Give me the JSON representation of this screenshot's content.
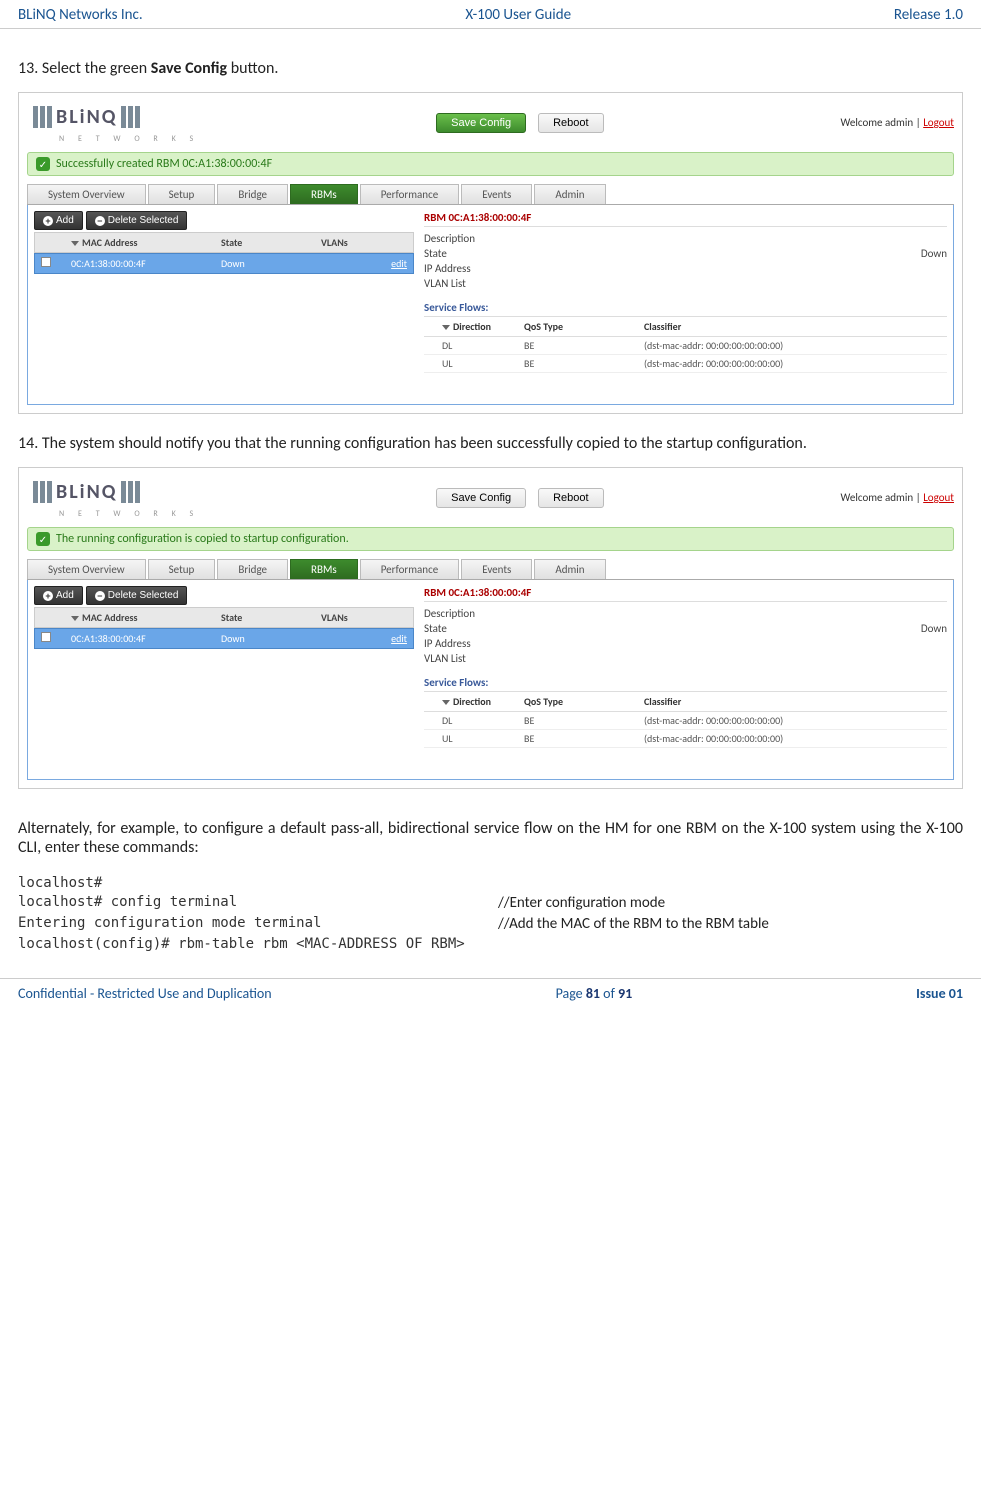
{
  "header": {
    "left": "BLiNQ Networks Inc.",
    "center": "X-100 User Guide",
    "right": "Release 1.0"
  },
  "step13": {
    "prefix": "13. Select the green ",
    "bold": "Save Config",
    "suffix": " button."
  },
  "step14": "14. The system should notify you that the running configuration has been successfully copied to the startup configuration.",
  "alt_para": "Alternately, for example, to configure a default pass-all, bidirectional service flow on the HM for one RBM on the X-100 system using the X-100 CLI, enter these commands:",
  "logo": {
    "main": "BLiNQ",
    "sub": "N E T W O R K S"
  },
  "buttons": {
    "save": "Save Config",
    "reboot": "Reboot"
  },
  "welcome": {
    "text": "Welcome admin  |  ",
    "logout": "Logout"
  },
  "banner1": "Successfully created RBM 0C:A1:38:00:00:4F",
  "banner2": "The running configuration is copied to startup configuration.",
  "tabs": {
    "overview": "System Overview",
    "setup": "Setup",
    "bridge": "Bridge",
    "rbms": "RBMs",
    "perf": "Performance",
    "events": "Events",
    "admin": "Admin"
  },
  "toolbar": {
    "add": "Add",
    "del": "Delete Selected"
  },
  "grid": {
    "mac_h": "MAC Address",
    "state_h": "State",
    "vlan_h": "VLANs",
    "row_mac": "0C:A1:38:00:00:4F",
    "row_state": "Down",
    "edit": "edit"
  },
  "details": {
    "title": "RBM 0C:A1:38:00:00:4F",
    "desc": "Description",
    "state": "State",
    "state_v": "Down",
    "ip": "IP Address",
    "vlan": "VLAN List",
    "svc": "Service Flows:",
    "dir": "Direction",
    "qos": "QoS Type",
    "cls": "Classifier",
    "dl": "DL",
    "ul": "UL",
    "be": "BE",
    "clsv": "(dst-mac-addr: 00:00:00:00:00:00)"
  },
  "cli": {
    "l1": "localhost#",
    "l2": "localhost# config terminal",
    "l3": "Entering configuration mode terminal",
    "l4": "localhost(config)# rbm-table rbm <MAC-ADDRESS OF RBM>",
    "c2": "//Enter configuration mode",
    "c3": "//Add the MAC of the RBM to the RBM table"
  },
  "footer": {
    "left": "Confidential - Restricted Use and Duplication",
    "page_a": "Page ",
    "page_b": "81",
    "page_c": " of ",
    "page_d": "91",
    "issue": "Issue 01"
  }
}
